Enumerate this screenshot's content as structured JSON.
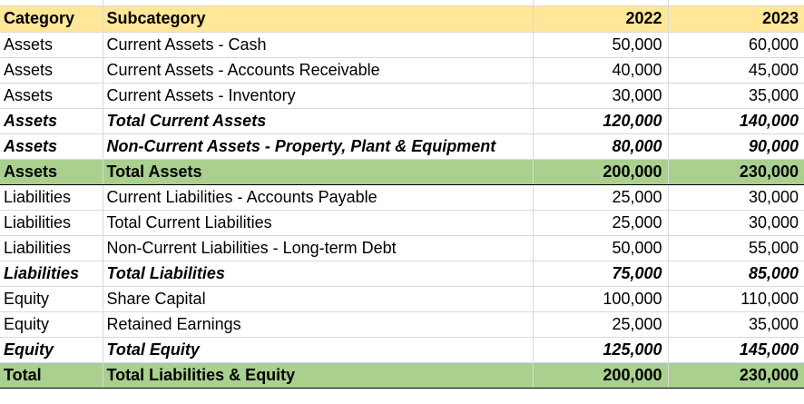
{
  "table": {
    "headers": [
      "Category",
      "Subcategory",
      "2022",
      "2023"
    ],
    "rows": [
      {
        "category": "Assets",
        "subcategory": "Current Assets - Cash",
        "y2022": "50,000",
        "y2023": "60,000",
        "style": "normal"
      },
      {
        "category": "Assets",
        "subcategory": "Current Assets - Accounts Receivable",
        "y2022": "40,000",
        "y2023": "45,000",
        "style": "normal"
      },
      {
        "category": "Assets",
        "subcategory": "Current Assets - Inventory",
        "y2022": "30,000",
        "y2023": "35,000",
        "style": "normal"
      },
      {
        "category": "Assets",
        "subcategory": "Total Current Assets",
        "y2022": "120,000",
        "y2023": "140,000",
        "style": "subtotal"
      },
      {
        "category": "Assets",
        "subcategory": "Non-Current Assets - Property, Plant & Equipment",
        "y2022": "80,000",
        "y2023": "90,000",
        "style": "subtotal"
      },
      {
        "category": "Assets",
        "subcategory": "Total Assets",
        "y2022": "200,000",
        "y2023": "230,000",
        "style": "total"
      },
      {
        "category": "Liabilities",
        "subcategory": "Current Liabilities - Accounts Payable",
        "y2022": "25,000",
        "y2023": "30,000",
        "style": "normal"
      },
      {
        "category": "Liabilities",
        "subcategory": "Total Current Liabilities",
        "y2022": "25,000",
        "y2023": "30,000",
        "style": "normal"
      },
      {
        "category": "Liabilities",
        "subcategory": "Non-Current Liabilities - Long-term Debt",
        "y2022": "50,000",
        "y2023": "55,000",
        "style": "normal"
      },
      {
        "category": "Liabilities",
        "subcategory": "Total Liabilities",
        "y2022": "75,000",
        "y2023": "85,000",
        "style": "subtotal"
      },
      {
        "category": "Equity",
        "subcategory": "Share Capital",
        "y2022": "100,000",
        "y2023": "110,000",
        "style": "subtotal-plain"
      },
      {
        "category": "Equity",
        "subcategory": "Retained Earnings",
        "y2022": "25,000",
        "y2023": "35,000",
        "style": "normal"
      },
      {
        "category": "Equity",
        "subcategory": "Total Equity",
        "y2022": "125,000",
        "y2023": "145,000",
        "style": "subtotal"
      },
      {
        "category": "Total",
        "subcategory": "Total Liabilities & Equity",
        "y2022": "200,000",
        "y2023": "230,000",
        "style": "total"
      }
    ]
  },
  "colors": {
    "header_fill": "#ffe699",
    "total_fill": "#a9d08e",
    "gridline": "#d9d9d9"
  }
}
